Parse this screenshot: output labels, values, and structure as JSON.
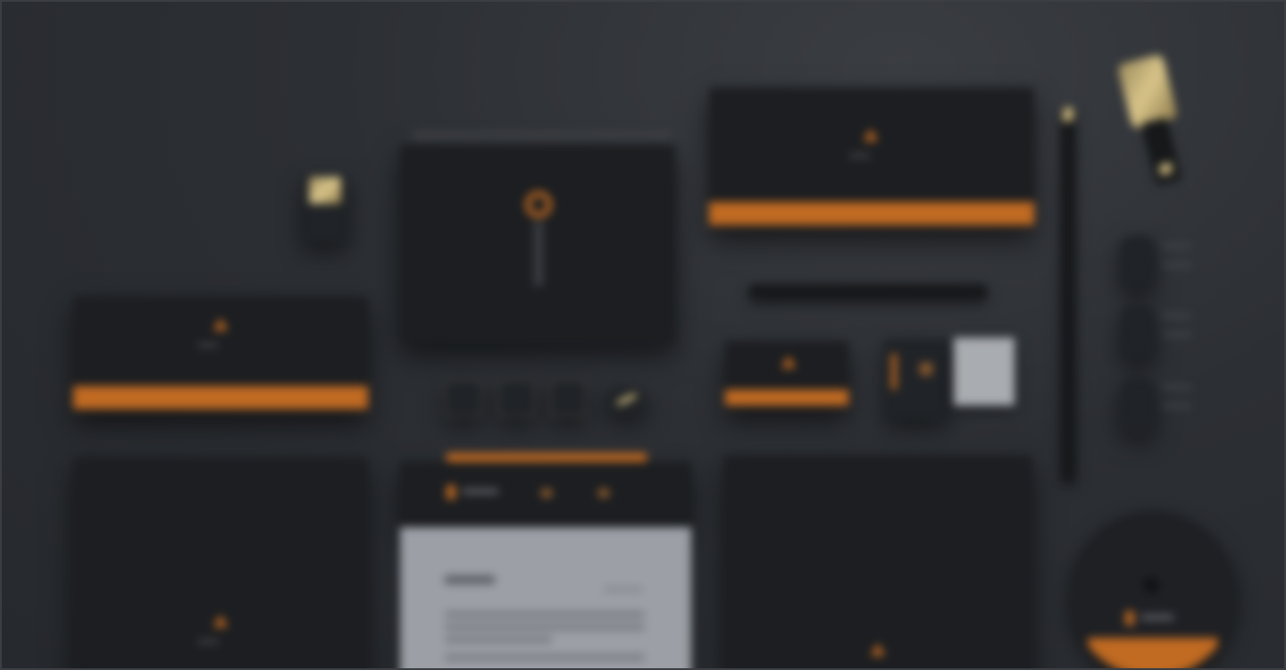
{
  "scene": {
    "description_colors": {
      "background": "#2b2e33",
      "accent": "#c06a22",
      "card": "#1c1e21",
      "paper": "#9ca0a6",
      "gold": "#d9c58a"
    },
    "icons": [
      "brand-logo-icon",
      "usb-drive-icon",
      "pencil-icon",
      "pen-icon",
      "clip-icon"
    ]
  }
}
